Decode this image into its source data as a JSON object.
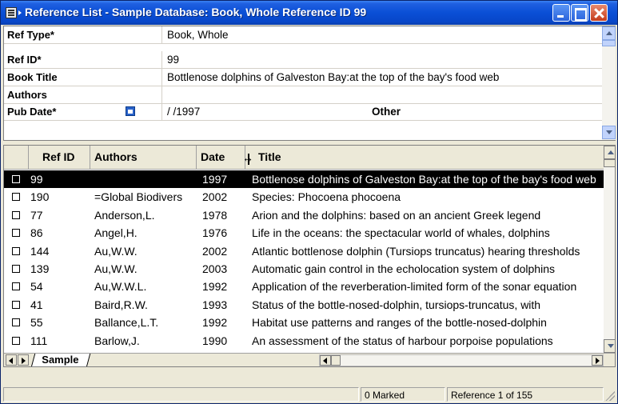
{
  "window": {
    "title": "Reference List - Sample Database: Book, Whole Reference ID 99"
  },
  "form": {
    "fields": [
      {
        "label": "Ref Type*",
        "value": "Book, Whole"
      },
      {
        "label": "Ref ID*",
        "value": "99"
      },
      {
        "label": "Book Title",
        "value": "Bottlenose dolphins of Galveston Bay:at the top of the bay's food web"
      },
      {
        "label": "Authors",
        "value": ""
      },
      {
        "label": "Pub Date*",
        "value": " /  /1997"
      }
    ],
    "other_label": "Other"
  },
  "list": {
    "columns": {
      "ref_id": "Ref ID",
      "authors": "Authors",
      "date": "Date",
      "title": "Title"
    },
    "rows": [
      {
        "id": "99",
        "authors": "",
        "date": "1997",
        "title": "Bottlenose dolphins of Galveston Bay:at the top of the bay's food web",
        "selected": true
      },
      {
        "id": "190",
        "authors": "=Global Biodivers",
        "date": "2002",
        "title": "Species: Phocoena phocoena"
      },
      {
        "id": "77",
        "authors": "Anderson,L.",
        "date": "1978",
        "title": "Arion and the dolphins: based on an ancient Greek legend"
      },
      {
        "id": "86",
        "authors": "Angel,H.",
        "date": "1976",
        "title": "Life in the oceans: the spectacular world of whales, dolphins"
      },
      {
        "id": "144",
        "authors": "Au,W.W.",
        "date": "2002",
        "title": "Atlantic bottlenose dolphin (Tursiops truncatus) hearing thresholds"
      },
      {
        "id": "139",
        "authors": "Au,W.W.",
        "date": "2003",
        "title": "Automatic gain control in the echolocation system of dolphins"
      },
      {
        "id": "54",
        "authors": "Au,W.W.L.",
        "date": "1992",
        "title": "Application of the reverberation-limited form of the sonar equation"
      },
      {
        "id": "41",
        "authors": "Baird,R.W.",
        "date": "1993",
        "title": "Status of the bottle-nosed-dolphin, tursiops-truncatus, with"
      },
      {
        "id": "55",
        "authors": "Ballance,L.T.",
        "date": "1992",
        "title": "Habitat use patterns and ranges of the bottle-nosed-dolphin"
      },
      {
        "id": "111",
        "authors": "Barlow,J.",
        "date": "1990",
        "title": "An assessment of the status of harbour porpoise populations"
      }
    ]
  },
  "tabs": {
    "sheet": "Sample"
  },
  "status": {
    "marked": "0 Marked",
    "position": "Reference 1 of 155"
  }
}
